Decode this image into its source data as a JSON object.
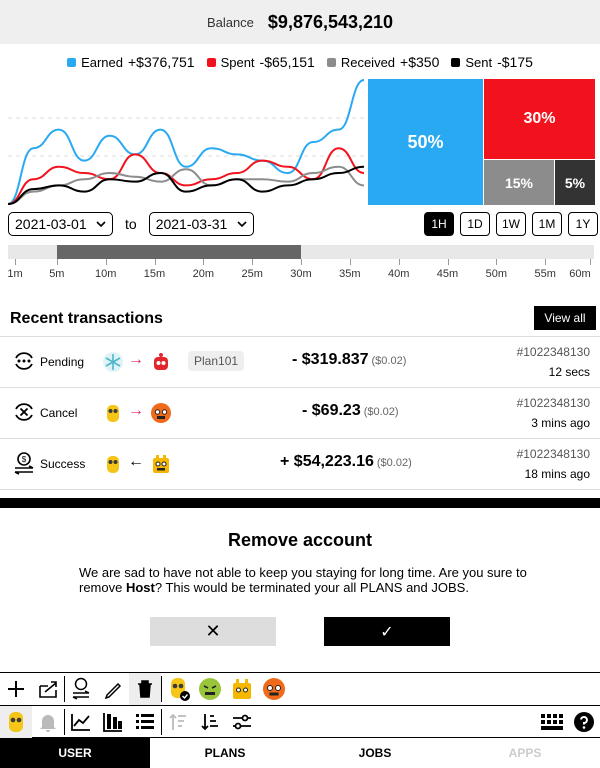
{
  "balance": {
    "label": "Balance",
    "value": "$9,876,543,210"
  },
  "legend": [
    {
      "name": "Earned",
      "value": "+$376,751",
      "color": "#2aa9f3"
    },
    {
      "name": "Spent",
      "value": "-$65,151",
      "color": "#f2121d"
    },
    {
      "name": "Received",
      "value": "+$350",
      "color": "#8c8c8c"
    },
    {
      "name": "Sent",
      "value": "-$175",
      "color": "#000000"
    }
  ],
  "treemap": [
    {
      "label": "50%",
      "color": "#2aa9f3"
    },
    {
      "label": "30%",
      "color": "#f2121d"
    },
    {
      "label": "15%",
      "color": "#8c8c8c"
    },
    {
      "label": "5%",
      "color": "#333333"
    }
  ],
  "date_range": {
    "from": "2021-03-01",
    "to_label": "to",
    "to": "2021-03-31"
  },
  "range_buttons": [
    {
      "label": "1H",
      "active": true
    },
    {
      "label": "1D",
      "active": false
    },
    {
      "label": "1W",
      "active": false
    },
    {
      "label": "1M",
      "active": false
    },
    {
      "label": "1Y",
      "active": false
    }
  ],
  "timeline": {
    "ticks": [
      "1m",
      "5m",
      "10m",
      "15m",
      "20m",
      "25m",
      "30m",
      "35m",
      "40m",
      "45m",
      "50m",
      "55m",
      "60m"
    ],
    "selection_start_min": 5,
    "selection_end_min": 30
  },
  "chart_data": {
    "type": "line",
    "title": "",
    "series": [
      {
        "name": "Earned",
        "values": [
          0,
          0.45,
          0.6,
          0.35,
          0.55,
          0.4,
          0.6,
          0.3,
          0.45,
          0.4,
          0.35,
          0.25,
          0.5,
          0.6,
          1.0
        ]
      },
      {
        "name": "Spent",
        "values": [
          0,
          0.2,
          0.3,
          0.25,
          0.2,
          0.4,
          0.25,
          0.15,
          0.2,
          0.25,
          0.35,
          0.3,
          0.2,
          0.45,
          0.25
        ]
      },
      {
        "name": "Received",
        "values": [
          0,
          0.1,
          0.15,
          0.2,
          0.25,
          0.22,
          0.18,
          0.28,
          0.15,
          0.2,
          0.2,
          0.18,
          0.25,
          0.3,
          0.15
        ]
      },
      {
        "name": "Sent",
        "values": [
          0,
          0.12,
          0.15,
          0.1,
          0.2,
          0.18,
          0.25,
          0.1,
          0.15,
          0.2,
          0.1,
          0.15,
          0.2,
          0.25,
          0.3
        ]
      }
    ]
  },
  "transactions_title": "Recent transactions",
  "view_all": "View all",
  "transactions": [
    {
      "status": "Pending",
      "status_icon": "pending-icon",
      "arrow": "→",
      "tag": "Plan101",
      "amount": "- $319.837",
      "fee": "($0.02)",
      "id": "#1022348130",
      "time": "12 secs"
    },
    {
      "status": "Cancel",
      "status_icon": "cancel-icon",
      "arrow": "→",
      "tag": "",
      "amount": "- $69.23",
      "fee": "($0.02)",
      "id": "#1022348130",
      "time": "3 mins ago"
    },
    {
      "status": "Success",
      "status_icon": "success-icon",
      "arrow": "←",
      "tag": "",
      "amount": "+ $54,223.16",
      "fee": "($0.02)",
      "id": "#1022348130",
      "time": "18 mins ago"
    }
  ],
  "modal": {
    "title": "Remove account",
    "text_before": "We are sad to have not able to keep you staying for long time. Are you sure to remove ",
    "name": "Host",
    "text_after": "? This would be terminated your all PLANS and JOBS.",
    "cancel": "✕",
    "confirm": "✓"
  },
  "tabs": [
    {
      "label": "USER",
      "state": "active"
    },
    {
      "label": "PLANS",
      "state": "normal"
    },
    {
      "label": "JOBS",
      "state": "normal"
    },
    {
      "label": "APPS",
      "state": "disabled"
    }
  ]
}
